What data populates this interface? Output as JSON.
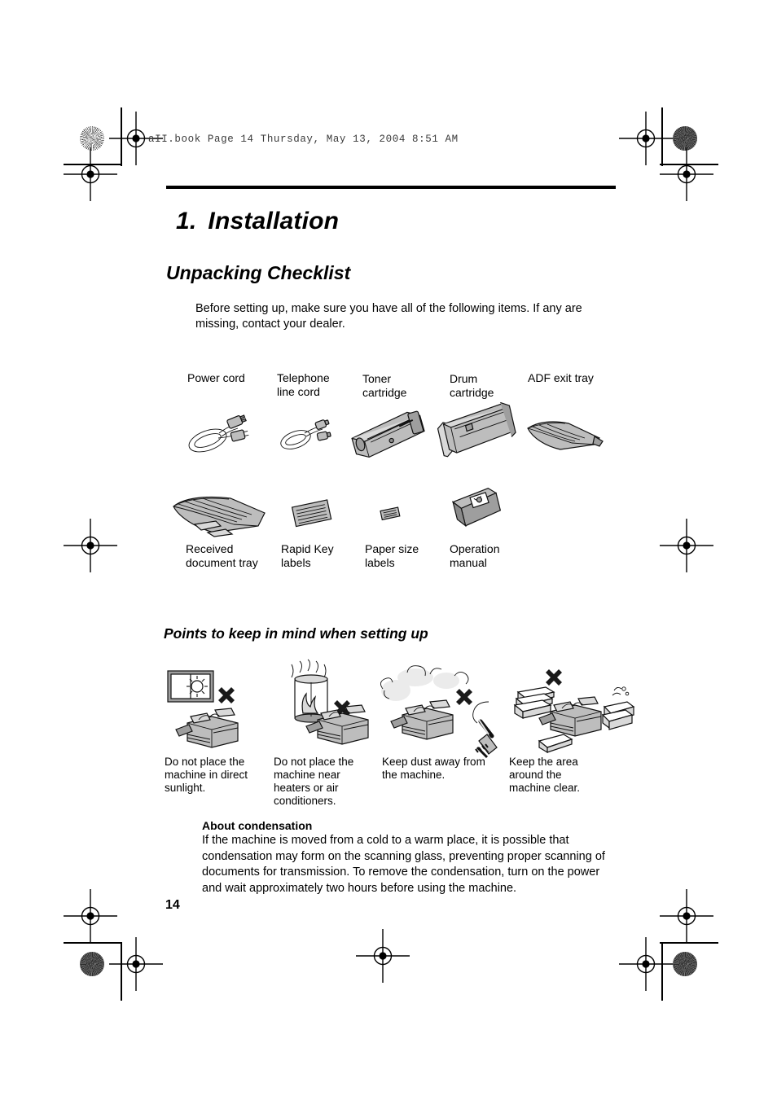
{
  "print_marks": {
    "header_text": "aII.book  Page 14  Thursday, May 13, 2004  8:51 AM"
  },
  "document": {
    "chapter_number": "1.",
    "chapter_title": "Installation",
    "section_title": "Unpacking Checklist",
    "intro": "Before setting up, make sure you have all of the following items. If any are missing, contact your dealer.",
    "page_number": "14"
  },
  "checklist": {
    "row1": [
      {
        "label": "Power cord",
        "icon": "power-cord-icon"
      },
      {
        "label": "Telephone\nline cord",
        "icon": "telephone-line-cord-icon"
      },
      {
        "label": "Toner\ncartridge",
        "icon": "toner-cartridge-icon"
      },
      {
        "label": "Drum\ncartridge",
        "icon": "drum-cartridge-icon"
      },
      {
        "label": "ADF exit tray",
        "icon": "adf-exit-tray-icon"
      }
    ],
    "row2": [
      {
        "label": "Received\ndocument tray",
        "icon": "received-document-tray-icon"
      },
      {
        "label": "Rapid Key\nlabels",
        "icon": "rapid-key-labels-icon"
      },
      {
        "label": "Paper size\nlabels",
        "icon": "paper-size-labels-icon"
      },
      {
        "label": "Operation\nmanual",
        "icon": "operation-manual-icon"
      }
    ]
  },
  "setup_points": {
    "heading": "Points to keep in mind when setting up",
    "items": [
      {
        "caption": "Do not place the\nmachine in direct\nsunlight.",
        "icon": "no-direct-sunlight-icon"
      },
      {
        "caption": "Do not place the\nmachine near\nheaters or air\nconditioners.",
        "icon": "no-heaters-icon"
      },
      {
        "caption": "Keep dust away from\nthe machine.",
        "icon": "no-dust-icon"
      },
      {
        "caption": "Keep the area\naround the\nmachine clear.",
        "icon": "keep-area-clear-icon"
      }
    ]
  },
  "condensation": {
    "heading": "About condensation",
    "body": "If the machine is moved from a cold to a warm place, it is possible that condensation may form on the scanning glass, preventing proper scanning of documents for transmission. To remove the condensation, turn on the power and wait approximately two hours before using the machine."
  }
}
